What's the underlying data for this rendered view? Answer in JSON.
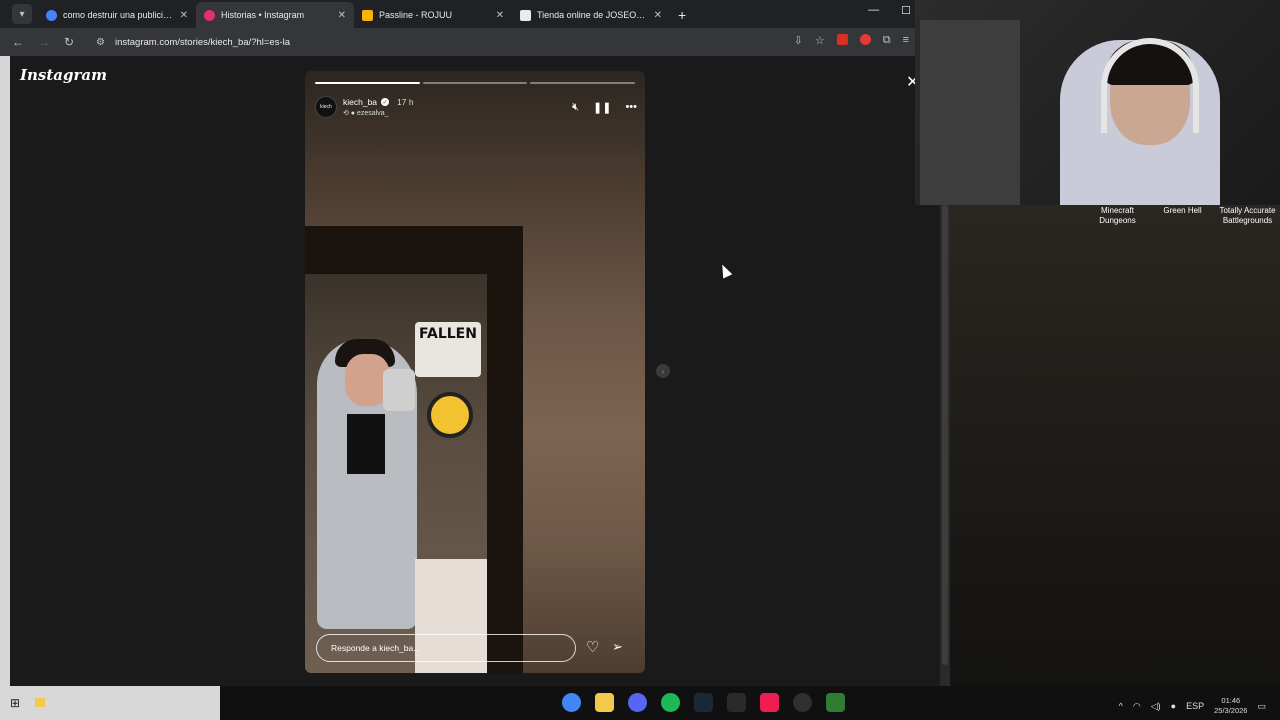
{
  "browser": {
    "tabs": [
      {
        "title": "como destruir una publicidad d",
        "active": false,
        "icon": "google-icon",
        "color": "#4285f4"
      },
      {
        "title": "Historias • Instagram",
        "active": true,
        "icon": "instagram-icon",
        "color": "#e1306c"
      },
      {
        "title": "Passline - ROJUU",
        "active": false,
        "icon": "passline-icon",
        "color": "#f4b400"
      },
      {
        "title": "Tienda online de JOSEOSHIRTS",
        "active": false,
        "icon": "store-icon",
        "color": "#e8eaed"
      }
    ],
    "url": "instagram.com/stories/kiech_ba/?hl=es-la"
  },
  "instagram": {
    "logo": "Instagram",
    "story": {
      "username": "kiech_ba",
      "time": "17 h",
      "avatar_text": "kiech",
      "reshared_from": "ezesalva_",
      "reply_placeholder": "Responde a kiech_ba...",
      "sticker_text": "FALLEN",
      "progress_segments": 3,
      "progress_done": 1
    }
  },
  "stream_overlay": {
    "games": [
      {
        "line1": "Minecraft",
        "line2": "Dungeons"
      },
      {
        "line1": "Green Hell",
        "line2": ""
      },
      {
        "line1": "Totally Accurate",
        "line2": "Battlegrounds"
      }
    ]
  },
  "taskbar": {
    "language": "ESP",
    "time": "01:46",
    "date": "25/3/2026",
    "apps": [
      {
        "name": "chrome",
        "color": "#4285f4"
      },
      {
        "name": "file-explorer",
        "color": "#f2c94c"
      },
      {
        "name": "discord",
        "color": "#5865f2"
      },
      {
        "name": "spotify",
        "color": "#1db954"
      },
      {
        "name": "steam",
        "color": "#1b2838"
      },
      {
        "name": "epic-games",
        "color": "#2a2a2a"
      },
      {
        "name": "tiktok",
        "color": "#ee1d52"
      },
      {
        "name": "obs",
        "color": "#302e31"
      },
      {
        "name": "cheat-engine",
        "color": "#2e7d32"
      }
    ]
  }
}
